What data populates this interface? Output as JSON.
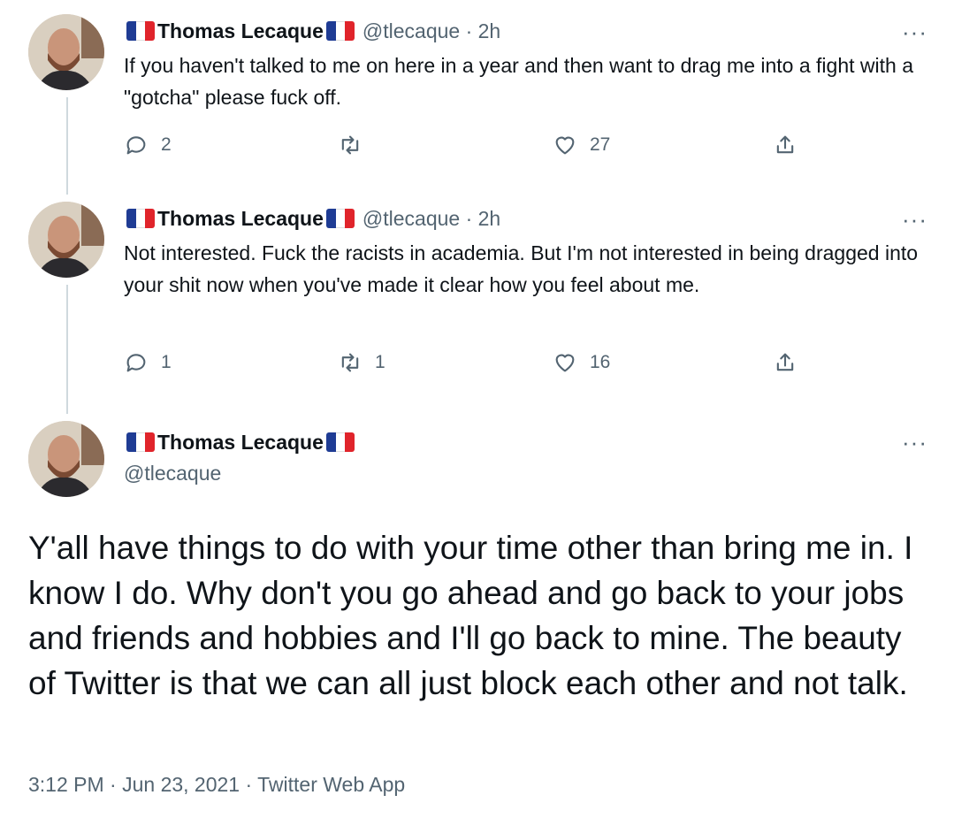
{
  "tweets": [
    {
      "author_name": "Thomas Lecaque",
      "handle_time": "@tlecaque · 2h",
      "text": "If you haven't talked to me on here in a year and then want to drag me into a fight with a \"gotcha\" please fuck off.",
      "replies": "2",
      "retweets": "",
      "likes": "27"
    },
    {
      "author_name": "Thomas Lecaque",
      "handle_time": "@tlecaque · 2h",
      "text": "Not interested. Fuck the racists in academia. But I'm not interested in being dragged into your shit now when you've made it clear how you feel about me.",
      "replies": "1",
      "retweets": "1",
      "likes": "16"
    }
  ],
  "main_tweet": {
    "author_name": "Thomas Lecaque",
    "handle": "@tlecaque",
    "text": "Y'all have things to do with your time other than bring me in. I know I do. Why don't you go ahead and go back to your jobs and friends and hobbies and I'll go back to mine. The beauty of Twitter is that we can all just block each other and not talk.",
    "meta": "3:12 PM · Jun 23, 2021 · Twitter Web App"
  },
  "more_label": "···",
  "icons": {
    "reply": "reply-icon",
    "retweet": "retweet-icon",
    "like": "heart-icon",
    "share": "share-icon",
    "flag": "french-flag-icon"
  },
  "colors": {
    "text": "#0f1419",
    "secondary": "#536471",
    "thread_line": "#cfd9de",
    "flag_blue": "#1f3c94",
    "flag_red": "#e0242b"
  }
}
